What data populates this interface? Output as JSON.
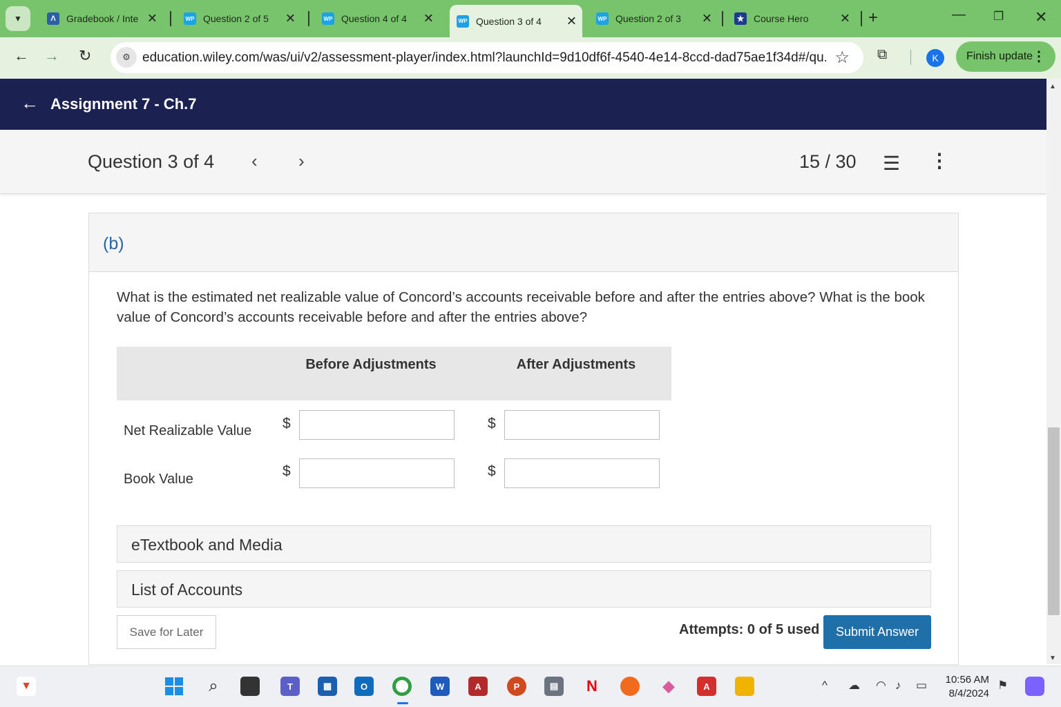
{
  "browser": {
    "tabs": [
      {
        "favicon": "gb",
        "title": "Gradebook / Inte",
        "active": false
      },
      {
        "favicon": "wp",
        "title": "Question 2 of 5",
        "active": false
      },
      {
        "favicon": "wp",
        "title": "Question 4 of 4",
        "active": false
      },
      {
        "favicon": "wp",
        "title": "Question 3 of 4",
        "active": true
      },
      {
        "favicon": "wp",
        "title": "Question 2 of 3",
        "active": false
      },
      {
        "favicon": "ch",
        "title": "Course Hero",
        "active": false
      }
    ],
    "favicon_labels": {
      "wp": "WP",
      "gb": "Λ",
      "ch": "★"
    },
    "url": "education.wiley.com/was/ui/v2/assessment-player/index.html?launchId=9d10df6f-4540-4e14-8ccd-dad75ae1f34d#/qu...",
    "profile_initial": "K",
    "finish_update_label": "Finish update",
    "accent_color": "#78c46c"
  },
  "assignment": {
    "title": "Assignment 7 - Ch.7"
  },
  "question_bar": {
    "label": "Question 3 of 4",
    "score": "15 / 30"
  },
  "part": {
    "label": "(b)",
    "question": "What is the estimated net realizable value of Concord’s accounts receivable before and after the entries above? What is the book value of Concord’s accounts receivable before and after the entries above?",
    "columns": [
      "Before Adjustments",
      "After Adjustments"
    ],
    "currency_symbol": "$",
    "rows": [
      {
        "label": "Net Realizable Value",
        "before": "",
        "after": ""
      },
      {
        "label": "Book Value",
        "before": "",
        "after": ""
      }
    ]
  },
  "resources": {
    "etextbook_label": "eTextbook and Media",
    "accounts_label": "List of Accounts"
  },
  "footer": {
    "save_label": "Save for Later",
    "attempts": "Attempts: 0 of 5 used",
    "submit_label": "Submit Answer",
    "submit_color": "#1f6fa8"
  },
  "taskbar": {
    "time": "10:56 AM",
    "date": "8/4/2024"
  }
}
